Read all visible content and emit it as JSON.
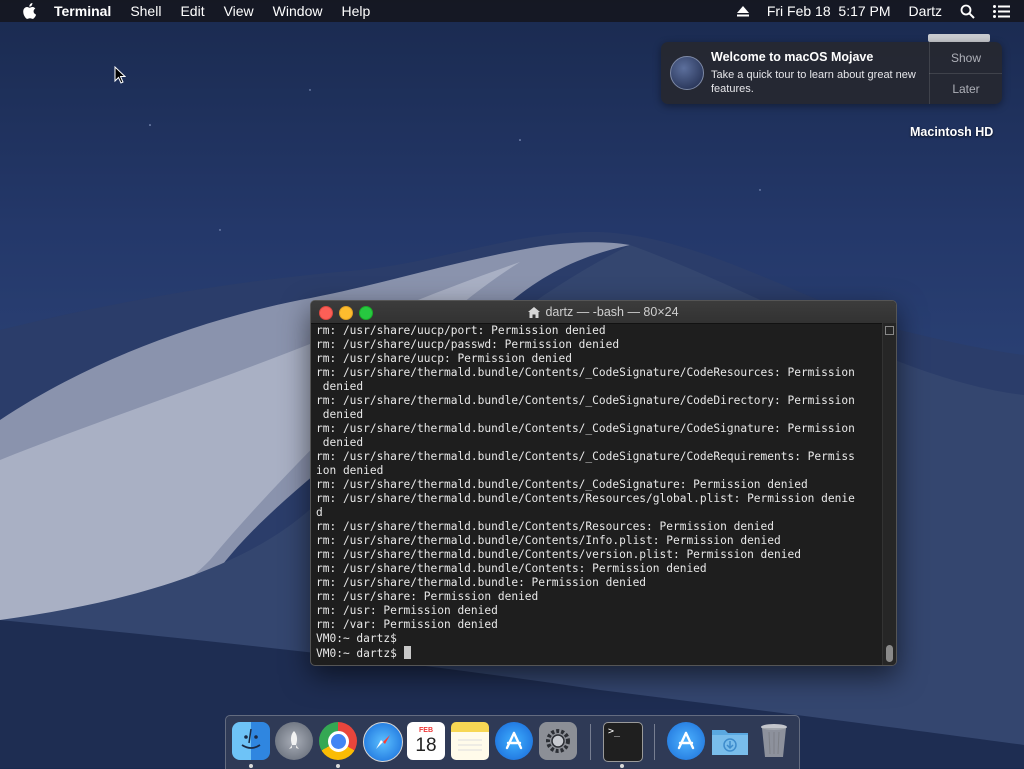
{
  "menubar": {
    "app_name": "Terminal",
    "menus": [
      "Shell",
      "Edit",
      "View",
      "Window",
      "Help"
    ],
    "datetime": "Fri Feb 18  5:17 PM",
    "user": "Dartz"
  },
  "notification": {
    "title": "Welcome to macOS Mojave",
    "body": "Take a quick tour to learn about great new features.",
    "show_label": "Show",
    "later_label": "Later"
  },
  "desktop": {
    "drive_label": "Macintosh HD"
  },
  "terminal": {
    "title": "dartz — -bash — 80×24",
    "lines": [
      "rm: /usr/share/uucp/port: Permission denied",
      "rm: /usr/share/uucp/passwd: Permission denied",
      "rm: /usr/share/uucp: Permission denied",
      "rm: /usr/share/thermald.bundle/Contents/_CodeSignature/CodeResources: Permission",
      " denied",
      "rm: /usr/share/thermald.bundle/Contents/_CodeSignature/CodeDirectory: Permission",
      " denied",
      "rm: /usr/share/thermald.bundle/Contents/_CodeSignature/CodeSignature: Permission",
      " denied",
      "rm: /usr/share/thermald.bundle/Contents/_CodeSignature/CodeRequirements: Permiss",
      "ion denied",
      "rm: /usr/share/thermald.bundle/Contents/_CodeSignature: Permission denied",
      "rm: /usr/share/thermald.bundle/Contents/Resources/global.plist: Permission denie",
      "d",
      "rm: /usr/share/thermald.bundle/Contents/Resources: Permission denied",
      "rm: /usr/share/thermald.bundle/Contents/Info.plist: Permission denied",
      "rm: /usr/share/thermald.bundle/Contents/version.plist: Permission denied",
      "rm: /usr/share/thermald.bundle/Contents: Permission denied",
      "rm: /usr/share/thermald.bundle: Permission denied",
      "rm: /usr/share: Permission denied",
      "rm: /usr: Permission denied",
      "rm: /var: Permission denied",
      "VM0:~ dartz$ ",
      "VM0:~ dartz$ "
    ]
  },
  "dock": {
    "apps": [
      "finder-icon",
      "launchpad-icon",
      "chrome-icon",
      "safari-icon",
      "calendar-icon",
      "notes-icon",
      "app-store-icon",
      "system-preferences-icon",
      "terminal-icon",
      "applications-folder-icon",
      "downloads-folder-icon",
      "trash-icon"
    ],
    "calendar_month": "FEB",
    "calendar_day": "18",
    "colors": {
      "finder": "#3d9bf2",
      "chrome": "#e8453c",
      "safari": "#1e8cf0",
      "appstore": "#1f8af4",
      "notes": "#f7d754"
    }
  }
}
